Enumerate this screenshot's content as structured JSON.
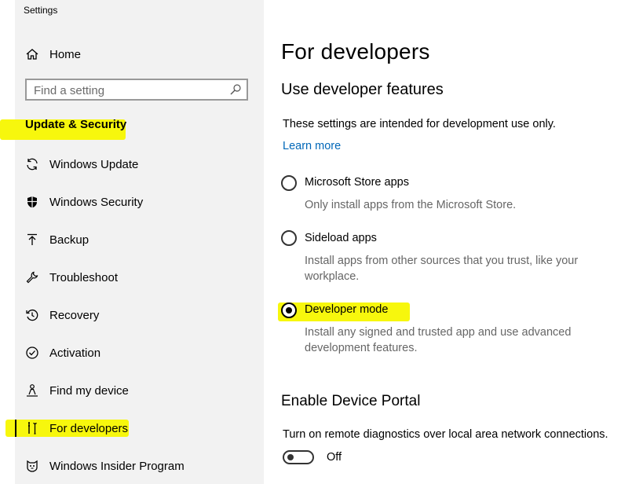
{
  "window": {
    "title": "Settings"
  },
  "sidebar": {
    "home_label": "Home",
    "search": {
      "placeholder": "Find a setting"
    },
    "section_label": "Update & Security",
    "items": [
      {
        "label": "Windows Update",
        "icon": "sync-icon"
      },
      {
        "label": "Windows Security",
        "icon": "shield-icon"
      },
      {
        "label": "Backup",
        "icon": "backup-arrow-icon"
      },
      {
        "label": "Troubleshoot",
        "icon": "wrench-icon"
      },
      {
        "label": "Recovery",
        "icon": "history-icon"
      },
      {
        "label": "Activation",
        "icon": "check-circle-icon"
      },
      {
        "label": "Find my device",
        "icon": "person-location-icon"
      },
      {
        "label": "For developers",
        "icon": "developer-tools-icon",
        "selected": true
      },
      {
        "label": "Windows Insider Program",
        "icon": "insider-cat-icon"
      }
    ]
  },
  "main": {
    "title": "For developers",
    "section_title": "Use developer features",
    "description": "These settings are intended for development use only.",
    "learn_more": "Learn more",
    "options": [
      {
        "label": "Microsoft Store apps",
        "description": "Only install apps from the Microsoft Store.",
        "checked": false
      },
      {
        "label": "Sideload apps",
        "description": "Install apps from other sources that you trust, like your workplace.",
        "checked": false
      },
      {
        "label": "Developer mode",
        "description": "Install any signed and trusted app and use advanced development features.",
        "checked": true
      }
    ],
    "portal": {
      "title": "Enable Device Portal",
      "description": "Turn on remote diagnostics over local area network connections.",
      "toggle_state": "Off"
    }
  },
  "colors": {
    "sidebar_bg": "#f2f2f2",
    "link": "#0067b8",
    "highlight": "#f7f700"
  }
}
